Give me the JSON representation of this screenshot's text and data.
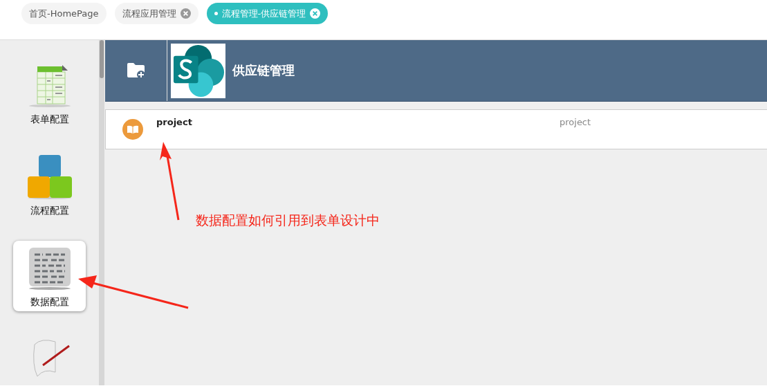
{
  "tabs": [
    {
      "label": "首页-HomePage",
      "selected": false,
      "closable": false
    },
    {
      "label": "流程应用管理",
      "selected": false,
      "closable": true
    },
    {
      "label": "流程管理-供应链管理",
      "selected": true,
      "closable": true
    }
  ],
  "sidebar": {
    "items": [
      {
        "kind": "form",
        "label": "表单配置",
        "selected": false
      },
      {
        "kind": "flow",
        "label": "流程配置",
        "selected": false
      },
      {
        "kind": "data",
        "label": "数据配置",
        "selected": true
      },
      {
        "kind": "scroll",
        "selected": false
      }
    ]
  },
  "header": {
    "title": "供应链管理"
  },
  "rows": [
    {
      "name": "project",
      "column_2": "project"
    }
  ],
  "annotation": {
    "text": "数据配置如何引用到表单设计中"
  }
}
